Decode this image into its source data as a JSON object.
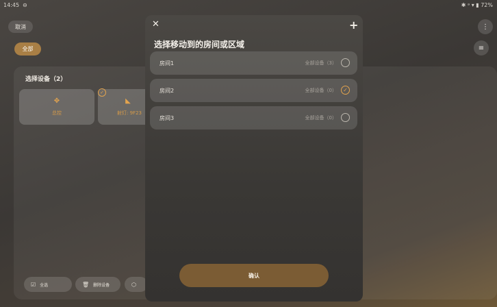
{
  "statusbar": {
    "time": "14:45",
    "sync_icon": "sync-icon",
    "right": "✱ ᵃ ▾ ▮ 72%"
  },
  "header": {
    "cancel_label": "取消",
    "filter_label": "全部"
  },
  "device_panel": {
    "title": "选择设备（2）",
    "cards": [
      {
        "label": "总控",
        "icon": "control-icon"
      },
      {
        "label": "射灯: 9F23",
        "icon": "spotlight-icon"
      }
    ]
  },
  "bottom_bar": [
    {
      "label": "全选",
      "icon": "select-all-icon"
    },
    {
      "label": "删除设备",
      "icon": "trash-icon"
    },
    {
      "label": "",
      "icon": "cube-icon"
    }
  ],
  "modal": {
    "title": "选择移动到的房间或区域",
    "rooms": [
      {
        "name": "房间1",
        "count": "全部设备（3）",
        "selected": false
      },
      {
        "name": "房间2",
        "count": "全部设备（0）",
        "selected": true
      },
      {
        "name": "房间3",
        "count": "全部设备（0）",
        "selected": false
      }
    ],
    "confirm_label": "确认"
  },
  "colors": {
    "accent": "#e3a44e",
    "chip": "#a97f45",
    "confirm": "#7b5c34"
  }
}
